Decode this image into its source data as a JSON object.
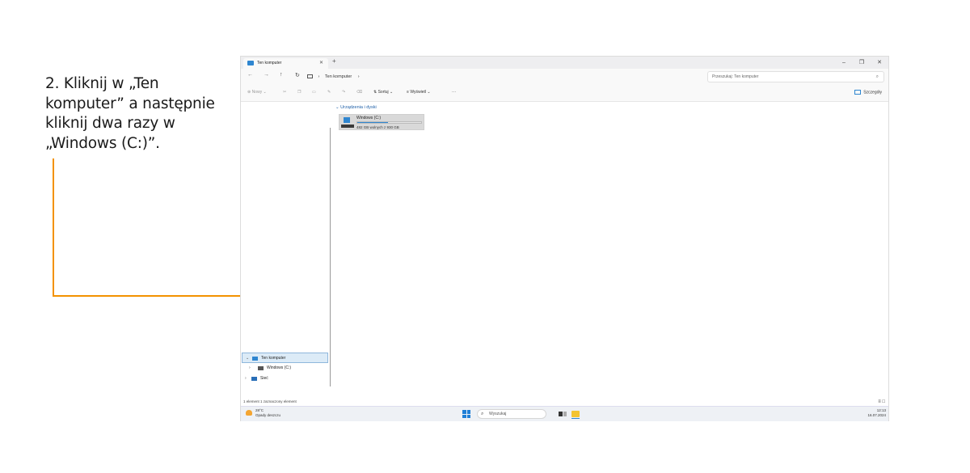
{
  "instruction": "2. Kliknij w „Ten komputer” a następnie kliknij dwa razy w „Windows (C:)”.",
  "colors": {
    "annotation": "#f39200",
    "accent": "#2f86d0",
    "selection": "#dcebf7"
  },
  "window": {
    "tab_title": "Ten komputer",
    "tab_close": "✕",
    "new_tab": "+",
    "controls": {
      "minimize": "–",
      "maximize": "❐",
      "close": "✕"
    }
  },
  "navbar": {
    "back": "←",
    "forward": "→",
    "up": "↑",
    "refresh": "↻",
    "breadcrumb_sep": "›",
    "breadcrumb_item": "Ten komputer",
    "search_placeholder": "Przeszukaj: Ten komputer",
    "search_icon": "⌕"
  },
  "toolbar": {
    "new_label": "Nowy",
    "sort_label": "Sortuj",
    "view_label": "Wyświetl",
    "more_label": "···",
    "details_label": "Szczegóły"
  },
  "sidebar": {
    "items": [
      {
        "label": "Ten komputer",
        "chevron": "⌄",
        "selected": true
      },
      {
        "label": "Windows (C:)",
        "chevron": "›",
        "selected": false
      },
      {
        "label": "Sieć",
        "chevron": "›",
        "selected": false
      }
    ]
  },
  "content": {
    "section_label": "⌄ Urządzenia i dyski",
    "drive": {
      "name": "Windows (C:)",
      "free_text": "482 GB wolnych z 930 GB",
      "used_fraction": 0.48
    }
  },
  "statusbar": {
    "text": "1 element   1 zaznaczony element",
    "view_icons": "≡ □"
  },
  "taskbar": {
    "temperature": "28°C",
    "weather": "Opady deszczu",
    "search_placeholder": "Wyszukaj",
    "time": "12:13",
    "date": "16.07.2024"
  }
}
